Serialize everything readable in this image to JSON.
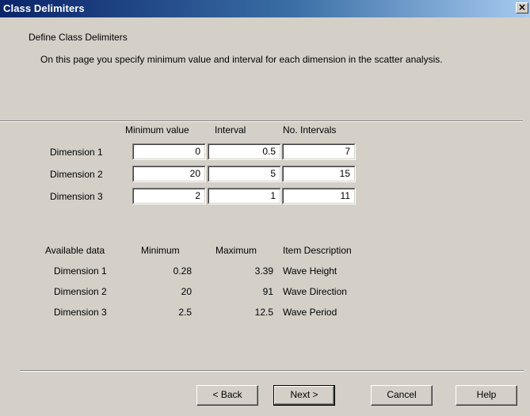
{
  "window": {
    "title": "Class Delimiters",
    "close_glyph": "×"
  },
  "page": {
    "heading": "Define Class Delimiters",
    "description": "On this page you specify minimum value and interval for each dimension in the scatter analysis."
  },
  "delimiters": {
    "headers": {
      "minimum": "Minimum value",
      "interval": "Interval",
      "count": "No. Intervals"
    },
    "rows": [
      {
        "label": "Dimension 1",
        "minimum": "0",
        "interval": "0.5",
        "count": "7"
      },
      {
        "label": "Dimension 2",
        "minimum": "20",
        "interval": "5",
        "count": "15"
      },
      {
        "label": "Dimension 3",
        "minimum": "2",
        "interval": "1",
        "count": "11"
      }
    ]
  },
  "available": {
    "headers": {
      "title": "Available data",
      "minimum": "Minimum",
      "maximum": "Maximum",
      "description": "Item Description"
    },
    "rows": [
      {
        "label": "Dimension 1",
        "minimum": "0.28",
        "maximum": "3.39",
        "description": "Wave Height"
      },
      {
        "label": "Dimension 2",
        "minimum": "20",
        "maximum": "91",
        "description": "Wave Direction"
      },
      {
        "label": "Dimension 3",
        "minimum": "2.5",
        "maximum": "12.5",
        "description": "Wave Period"
      }
    ]
  },
  "buttons": {
    "back": "< Back",
    "next": "Next >",
    "cancel": "Cancel",
    "help": "Help"
  }
}
